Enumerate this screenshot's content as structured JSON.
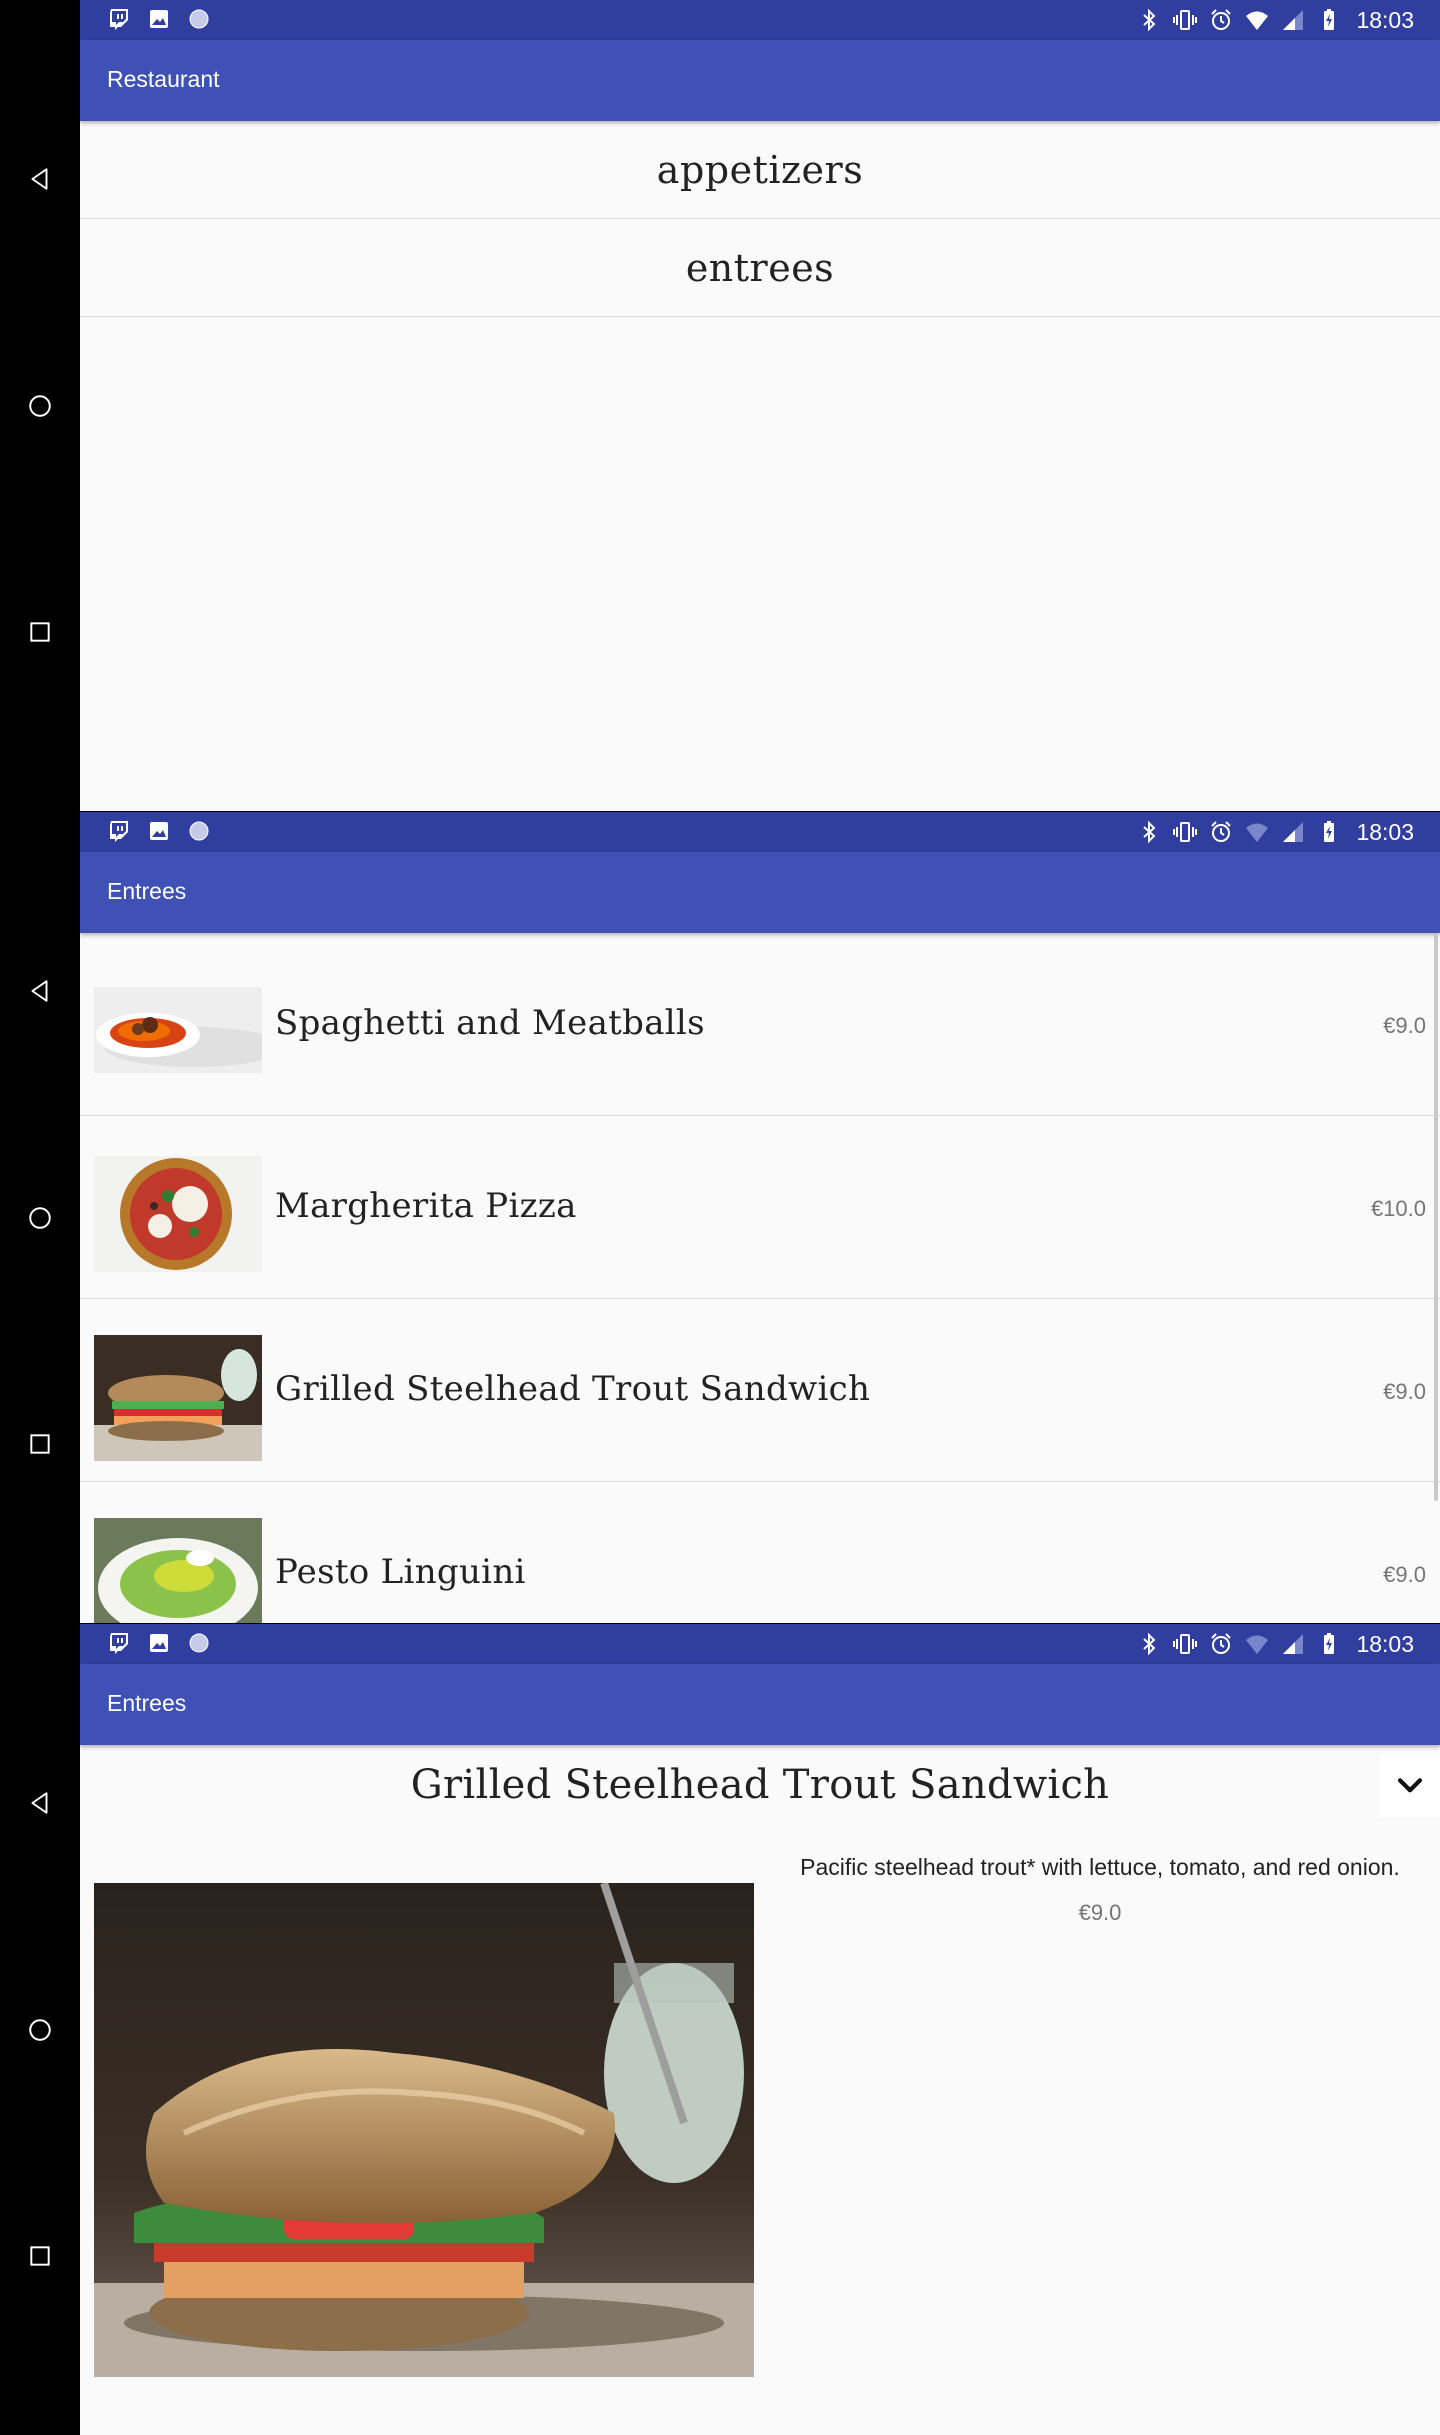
{
  "status_bar": {
    "time": "18:03",
    "left_icons": [
      "twitch-icon",
      "image-notification-icon",
      "circle-notification-icon"
    ],
    "right_icons": [
      "bluetooth-icon",
      "vibrate-icon",
      "alarm-icon",
      "wifi-icon",
      "signal-icon",
      "battery-icon"
    ]
  },
  "colors": {
    "status_bar": "#303f9f",
    "toolbar": "#3f51b5",
    "background": "#fafafa",
    "divider": "#dcdcdc",
    "price_text": "#757575"
  },
  "nav_bar": {
    "icons": [
      "back-icon",
      "home-icon",
      "recents-icon"
    ]
  },
  "screen1": {
    "title": "Restaurant",
    "categories": [
      {
        "label": "appetizers"
      },
      {
        "label": "entrees"
      }
    ]
  },
  "screen2": {
    "title": "Entrees",
    "items": [
      {
        "name": "Spaghetti and Meatballs",
        "price": "€9.0",
        "image": "spaghetti-image"
      },
      {
        "name": "Margherita Pizza",
        "price": "€10.0",
        "image": "pizza-image"
      },
      {
        "name": "Grilled Steelhead Trout Sandwich",
        "price": "€9.0",
        "image": "sandwich-image"
      },
      {
        "name": "Pesto Linguini",
        "price": "€9.0",
        "image": "linguini-image"
      }
    ]
  },
  "screen3": {
    "title": "Entrees",
    "item_name": "Grilled Steelhead Trout Sandwich",
    "description": "Pacific steelhead trout* with lettuce, tomato, and red onion.",
    "price": "€9.0",
    "collapse_icon": "chevron-down-icon"
  }
}
